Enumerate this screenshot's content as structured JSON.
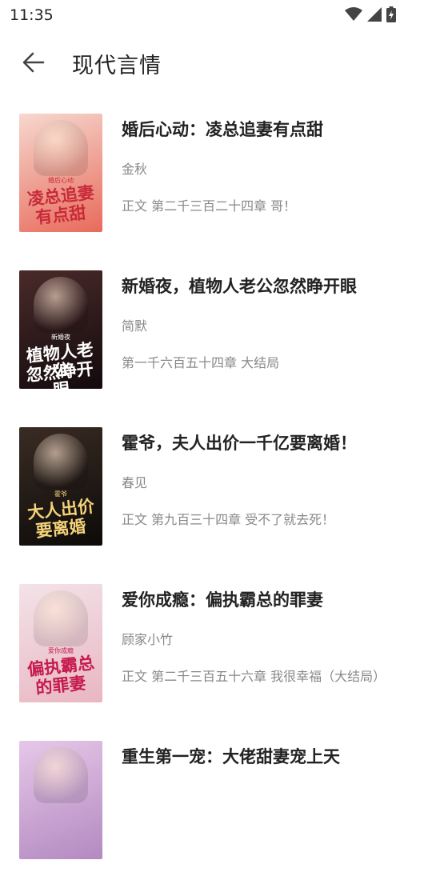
{
  "status_bar": {
    "time": "11:35",
    "icons": [
      "wifi-icon",
      "signal-icon",
      "battery-charging-icon"
    ]
  },
  "app_bar": {
    "back_icon": "arrow-left-icon",
    "title": "现代言情"
  },
  "books": [
    {
      "title": "婚后心动：凌总追妻有点甜",
      "author": "金秋",
      "chapter": "正文 第二千三百二十四章 哥！",
      "cover": {
        "title_lines": [
          "凌总追妻",
          "有点甜"
        ],
        "sub": "婚后心动",
        "bg1": "#f6d8cf",
        "bg2": "#e86b5b",
        "text": "#c82a3a"
      }
    },
    {
      "title": "新婚夜，植物人老公忽然睁开眼",
      "author": "简默",
      "chapter": "第一千六百五十四章 大结局",
      "cover": {
        "title_lines": [
          "植物人老公",
          "忽然睁开眼"
        ],
        "sub": "新婚夜",
        "bg1": "#4a2a2a",
        "bg2": "#120a0c",
        "text": "#ffffff"
      }
    },
    {
      "title": "霍爷，夫人出价一千亿要离婚！",
      "author": "春见",
      "chapter": "正文 第九百三十四章 受不了就去死！",
      "cover": {
        "title_lines": [
          "大人出价",
          "要离婚"
        ],
        "sub": "霍爷",
        "bg1": "#3a2c24",
        "bg2": "#0c0a08",
        "text": "#f4d37a"
      }
    },
    {
      "title": "爱你成瘾：偏执霸总的罪妻",
      "author": "顾家小竹",
      "chapter": "正文 第二千三百五十六章 我很幸福（大结局）",
      "cover": {
        "title_lines": [
          "偏执霸总",
          "的罪妻"
        ],
        "sub": "爱你成瘾",
        "bg1": "#f3e3e8",
        "bg2": "#e9b6c3",
        "text": "#c51a4e"
      }
    },
    {
      "title": "重生第一宠：大佬甜妻宠上天",
      "author": "",
      "chapter": "",
      "cover": {
        "title_lines": [
          ""
        ],
        "sub": "",
        "bg1": "#e6c7e8",
        "bg2": "#b38ac1",
        "text": "#ffffff"
      }
    }
  ]
}
